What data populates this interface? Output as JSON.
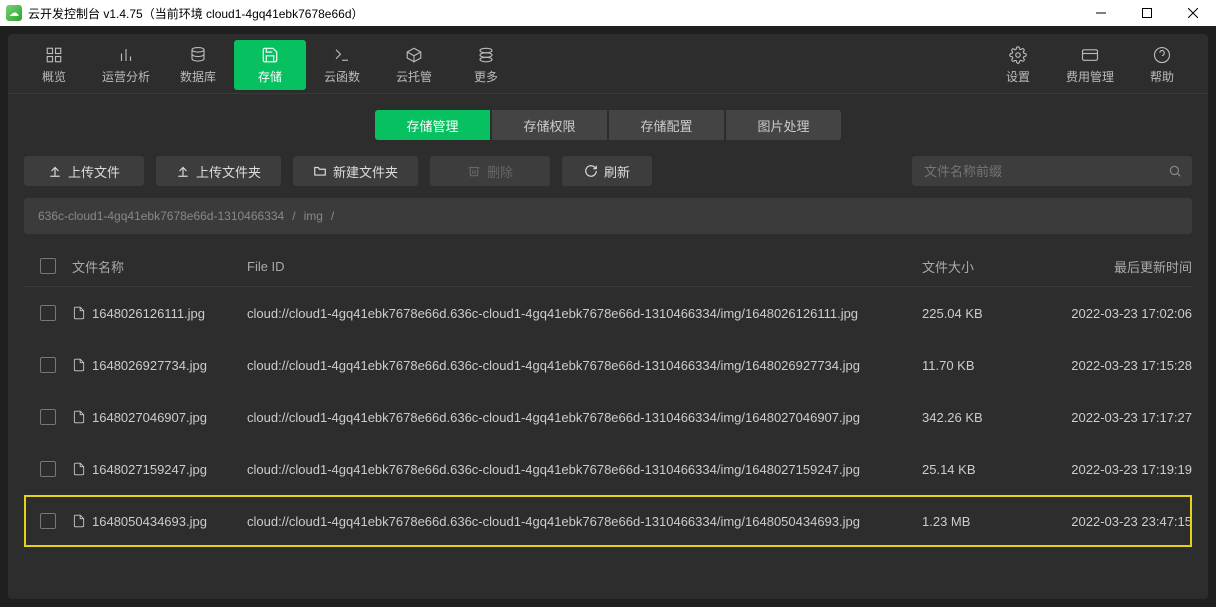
{
  "window": {
    "title": "云开发控制台 v1.4.75（当前环境 cloud1-4gq41ebk7678e66d）"
  },
  "nav": {
    "left": [
      {
        "label": "概览"
      },
      {
        "label": "运营分析"
      },
      {
        "label": "数据库"
      },
      {
        "label": "存储",
        "active": true
      },
      {
        "label": "云函数"
      },
      {
        "label": "云托管"
      },
      {
        "label": "更多"
      }
    ],
    "right": [
      {
        "label": "设置"
      },
      {
        "label": "费用管理"
      },
      {
        "label": "帮助"
      }
    ]
  },
  "tabs": [
    {
      "label": "存储管理",
      "active": true
    },
    {
      "label": "存储权限"
    },
    {
      "label": "存储配置"
    },
    {
      "label": "图片处理"
    }
  ],
  "actions": {
    "upload_file": "上传文件",
    "upload_folder": "上传文件夹",
    "new_folder": "新建文件夹",
    "delete": "删除",
    "refresh": "刷新"
  },
  "search": {
    "placeholder": "文件名称前缀"
  },
  "breadcrumb": {
    "root": "636c-cloud1-4gq41ebk7678e66d-1310466334",
    "sep": "/",
    "folder": "img",
    "tail": "/"
  },
  "columns": {
    "name": "文件名称",
    "id": "File ID",
    "size": "文件大小",
    "time": "最后更新时间"
  },
  "rows": [
    {
      "name": "1648026126111.jpg",
      "id": "cloud://cloud1-4gq41ebk7678e66d.636c-cloud1-4gq41ebk7678e66d-1310466334/img/1648026126111.jpg",
      "size": "225.04 KB",
      "time": "2022-03-23 17:02:06",
      "hl": false
    },
    {
      "name": "1648026927734.jpg",
      "id": "cloud://cloud1-4gq41ebk7678e66d.636c-cloud1-4gq41ebk7678e66d-1310466334/img/1648026927734.jpg",
      "size": "11.70 KB",
      "time": "2022-03-23 17:15:28",
      "hl": false
    },
    {
      "name": "1648027046907.jpg",
      "id": "cloud://cloud1-4gq41ebk7678e66d.636c-cloud1-4gq41ebk7678e66d-1310466334/img/1648027046907.jpg",
      "size": "342.26 KB",
      "time": "2022-03-23 17:17:27",
      "hl": false
    },
    {
      "name": "1648027159247.jpg",
      "id": "cloud://cloud1-4gq41ebk7678e66d.636c-cloud1-4gq41ebk7678e66d-1310466334/img/1648027159247.jpg",
      "size": "25.14 KB",
      "time": "2022-03-23 17:19:19",
      "hl": false
    },
    {
      "name": "1648050434693.jpg",
      "id": "cloud://cloud1-4gq41ebk7678e66d.636c-cloud1-4gq41ebk7678e66d-1310466334/img/1648050434693.jpg",
      "size": "1.23 MB",
      "time": "2022-03-23 23:47:15",
      "hl": true
    }
  ]
}
